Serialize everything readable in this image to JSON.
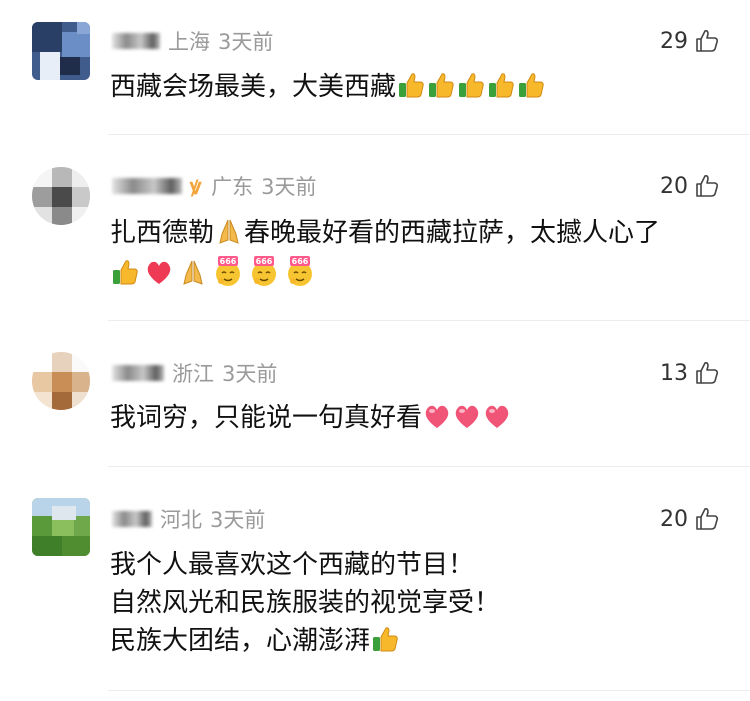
{
  "comments": [
    {
      "location": "上海",
      "time": "3天前",
      "likes": "29",
      "text": "西藏会场最美，大美西藏",
      "emojis": [
        "thumbs-up-emoji",
        "thumbs-up-emoji",
        "thumbs-up-emoji",
        "thumbs-up-emoji",
        "thumbs-up-emoji"
      ]
    },
    {
      "location": "广东",
      "time": "3天前",
      "likes": "20",
      "text_part1": "扎西德勒",
      "text_part2": "春晚最好看的西藏拉萨，太撼人心了",
      "emojis": [
        "praying-hands-emoji",
        "thumbs-up-emoji",
        "red-heart-emoji",
        "praying-hands-emoji",
        "666-emoji",
        "666-emoji",
        "666-emoji"
      ]
    },
    {
      "location": "浙江",
      "time": "3天前",
      "likes": "13",
      "text": "我词穷，只能说一句真好看",
      "emojis": [
        "pink-heart-emoji",
        "pink-heart-emoji",
        "pink-heart-emoji"
      ]
    },
    {
      "location": "河北",
      "time": "3天前",
      "likes": "20",
      "lines": [
        "我个人最喜欢这个西藏的节目！",
        "自然风光和民族服装的视觉享受！",
        "民族大团结，心潮澎湃"
      ],
      "emojis": [
        "thumbs-up-emoji"
      ]
    }
  ],
  "colors": {
    "meta_gray": "#9a9a9a",
    "vip_orange": "#f2a53a",
    "divider": "#ececec"
  }
}
